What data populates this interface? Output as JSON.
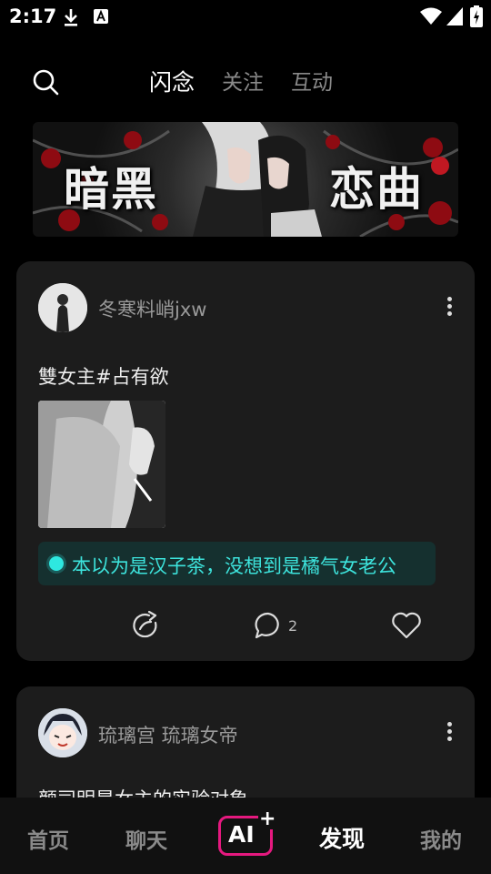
{
  "status_bar": {
    "time": "2:17"
  },
  "top_nav": {
    "tabs": [
      {
        "label": "闪念"
      },
      {
        "label": "关注"
      },
      {
        "label": "互动"
      }
    ]
  },
  "banner": {
    "title_left": "暗黑",
    "title_right": "恋曲"
  },
  "posts": [
    {
      "username": "冬寒料峭jxw",
      "text": "雙女主#占有欲",
      "topic": "本以为是汉子茶，没想到是橘气女老公",
      "comment_count": "2"
    },
    {
      "username": "琉璃宫 琉璃女帝",
      "text": "颜司明是女主的实验对象"
    }
  ],
  "bottom_nav": {
    "home": "首页",
    "chat": "聊天",
    "ai": "AI",
    "ai_plus": "+",
    "discover": "发现",
    "mine": "我的"
  },
  "colors": {
    "accent_teal": "#3de3dc",
    "ai_magenta": "#e5197f",
    "card_bg": "#1c1c1c"
  }
}
